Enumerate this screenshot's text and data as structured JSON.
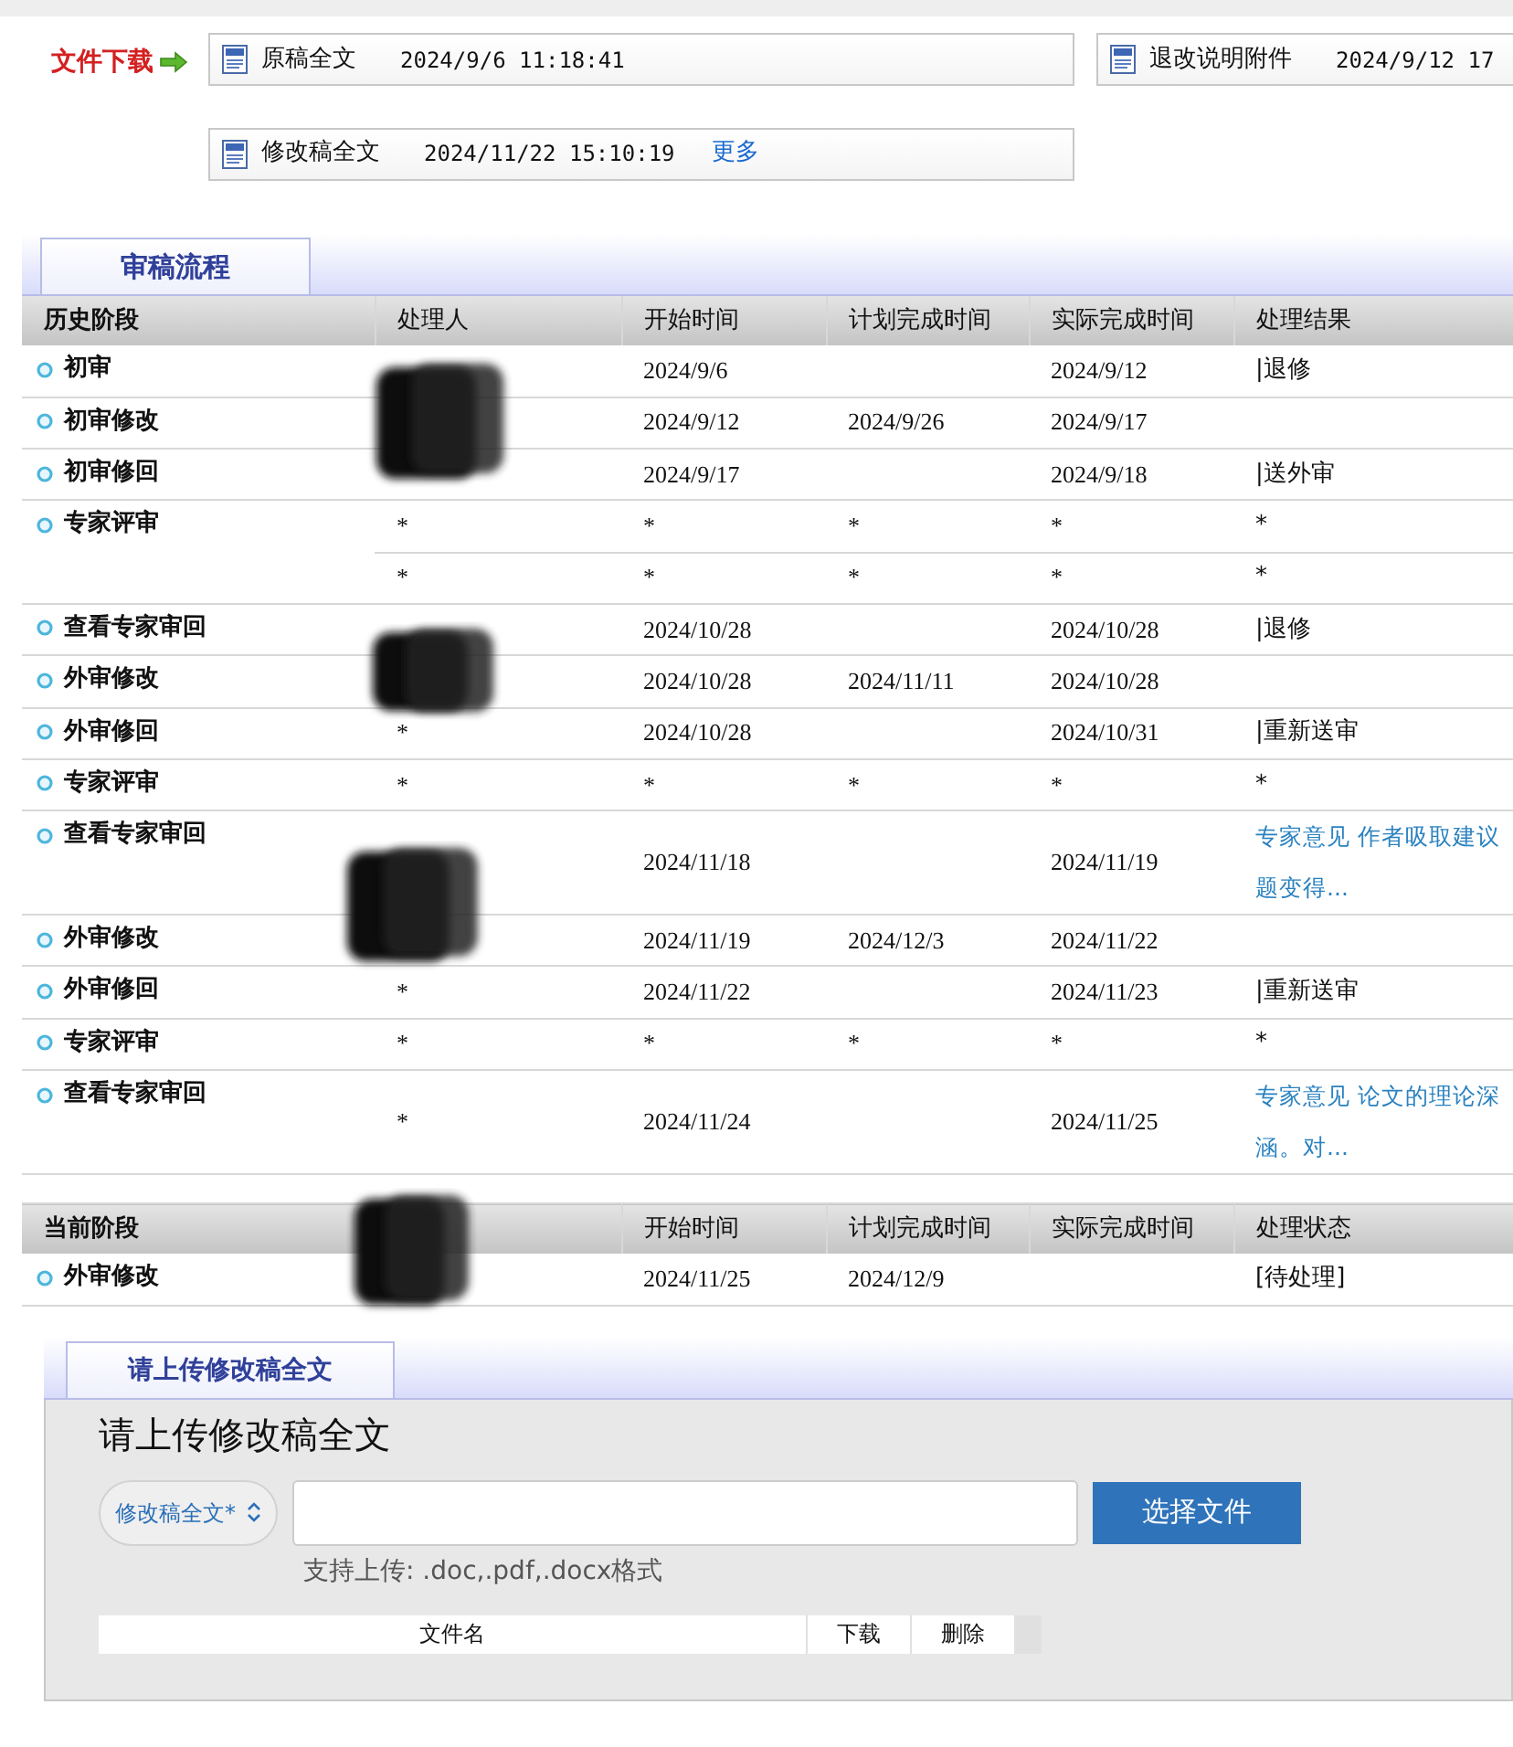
{
  "downloads": {
    "label": "文件下载",
    "files": [
      {
        "name": "原稿全文",
        "time": "2024/9/6 11:18:41"
      },
      {
        "name": "退改说明附件",
        "time": "2024/9/12 17"
      },
      {
        "name": "修改稿全文",
        "time": "2024/11/22 15:10:19",
        "more": "更多"
      }
    ]
  },
  "review_tab": "审稿流程",
  "history": {
    "columns": [
      "历史阶段",
      "处理人",
      "开始时间",
      "计划完成时间",
      "实际完成时间",
      "处理结果"
    ],
    "rows": [
      {
        "stage": "初审",
        "entries": [
          {
            "start": "2024/9/6",
            "actual": "2024/9/12",
            "result": "|退修"
          }
        ]
      },
      {
        "stage": "初审修改",
        "entries": [
          {
            "start": "2024/9/12",
            "planned": "2024/9/26",
            "actual": "2024/9/17"
          }
        ]
      },
      {
        "stage": "初审修回",
        "entries": [
          {
            "start": "2024/9/17",
            "actual": "2024/9/18",
            "result": "|送外审"
          }
        ]
      },
      {
        "stage": "专家评审",
        "entries": [
          {
            "handler": "*",
            "start": "*",
            "planned": "*",
            "actual": "*",
            "result": "*"
          },
          {
            "handler": "*",
            "start": "*",
            "planned": "*",
            "actual": "*",
            "result": "*"
          }
        ]
      },
      {
        "stage": "查看专家审回",
        "entries": [
          {
            "start": "2024/10/28",
            "actual": "2024/10/28",
            "result": "|退修"
          }
        ]
      },
      {
        "stage": "外审修改",
        "entries": [
          {
            "start": "2024/10/28",
            "planned": "2024/11/11",
            "actual": "2024/10/28"
          }
        ]
      },
      {
        "stage": "外审修回",
        "entries": [
          {
            "handler": "*",
            "start": "2024/10/28",
            "actual": "2024/10/31",
            "result": "|重新送审"
          }
        ]
      },
      {
        "stage": "专家评审",
        "entries": [
          {
            "handler": "*",
            "start": "*",
            "planned": "*",
            "actual": "*",
            "result": "*"
          }
        ]
      },
      {
        "stage": "查看专家审回",
        "entries": [
          {
            "start": "2024/11/18",
            "actual": "2024/11/19",
            "opinion_lines": [
              "专家意见 作者吸取建议",
              "题变得..."
            ]
          }
        ]
      },
      {
        "stage": "外审修改",
        "entries": [
          {
            "start": "2024/11/19",
            "planned": "2024/12/3",
            "actual": "2024/11/22"
          }
        ]
      },
      {
        "stage": "外审修回",
        "entries": [
          {
            "handler": "*",
            "start": "2024/11/22",
            "actual": "2024/11/23",
            "result": "|重新送审"
          }
        ]
      },
      {
        "stage": "专家评审",
        "entries": [
          {
            "handler": "*",
            "start": "*",
            "planned": "*",
            "actual": "*",
            "result": "*"
          }
        ]
      },
      {
        "stage": "查看专家审回",
        "entries": [
          {
            "handler": "*",
            "start": "2024/11/24",
            "actual": "2024/11/25",
            "opinion_lines": [
              "专家意见 论文的理论深",
              "涵。对..."
            ]
          }
        ]
      }
    ]
  },
  "current": {
    "columns": [
      "当前阶段",
      "",
      "开始时间",
      "计划完成时间",
      "实际完成时间",
      "处理状态"
    ],
    "rows": [
      {
        "stage": "外审修改",
        "entries": [
          {
            "start": "2024/11/25",
            "planned": "2024/12/9",
            "result": "[待处理]"
          }
        ]
      }
    ]
  },
  "upload": {
    "tab": "请上传修改稿全文",
    "title": "请上传修改稿全文",
    "file_type": "修改稿全文*",
    "button": "选择文件",
    "hint": "支持上传: .doc,.pdf,.docx格式",
    "file_columns": [
      "文件名",
      "下载",
      "删除"
    ]
  }
}
